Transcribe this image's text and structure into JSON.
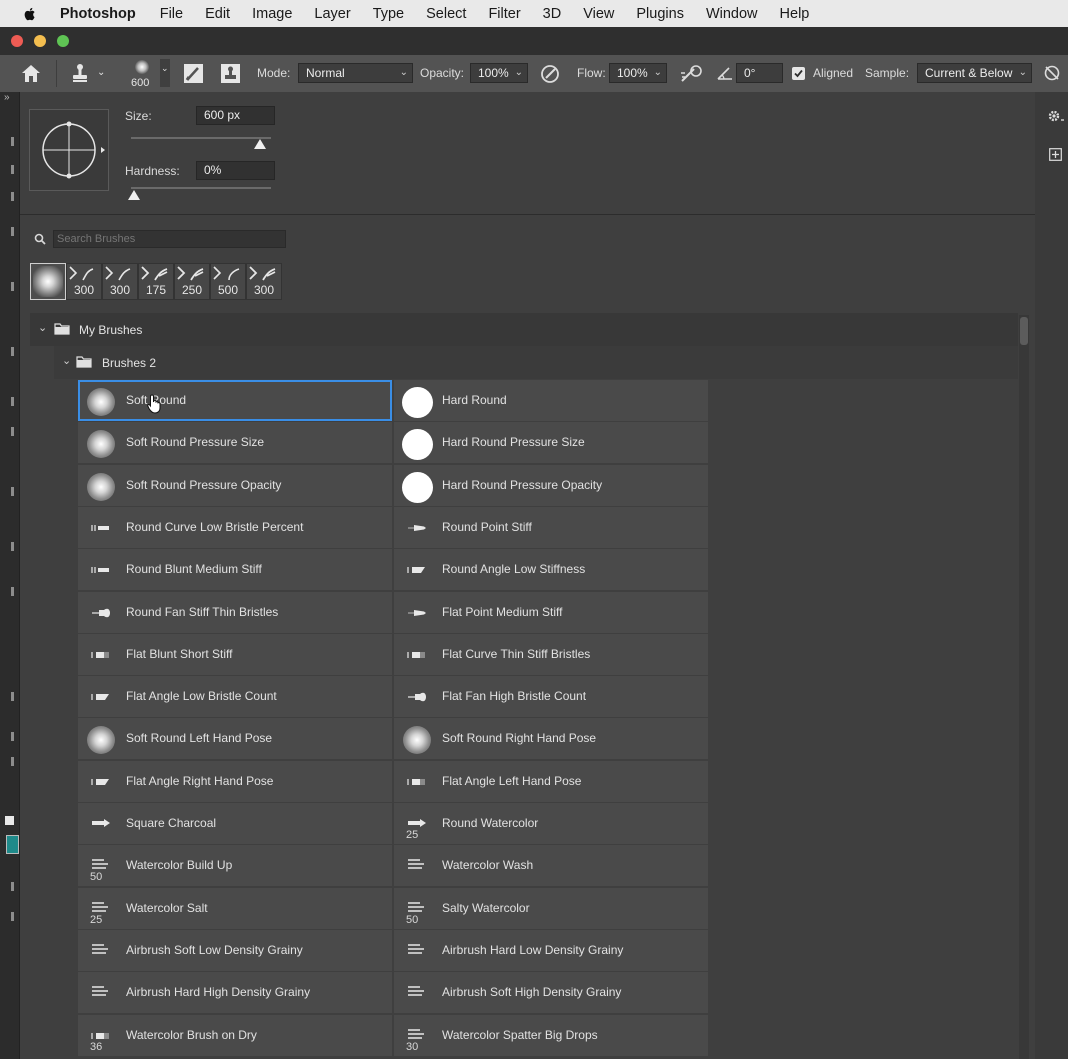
{
  "menubar": {
    "app_name": "Photoshop",
    "items": [
      "File",
      "Edit",
      "Image",
      "Layer",
      "Type",
      "Select",
      "Filter",
      "3D",
      "View",
      "Plugins",
      "Window",
      "Help"
    ]
  },
  "options_bar": {
    "brush_size_preview": "600",
    "mode_label": "Mode:",
    "mode_value": "Normal",
    "opacity_label": "Opacity:",
    "opacity_value": "100%",
    "flow_label": "Flow:",
    "flow_value": "100%",
    "angle_value": "0°",
    "aligned_label": "Aligned",
    "aligned_checked": true,
    "sample_label": "Sample:",
    "sample_value": "Current & Below"
  },
  "brush_panel": {
    "size_label": "Size:",
    "size_value": "600 px",
    "size_fraction": 0.92,
    "hardness_label": "Hardness:",
    "hardness_value": "0%",
    "hardness_fraction": 0.0,
    "search_placeholder": "Search Brushes",
    "recent_brushes": [
      "300",
      "300",
      "175",
      "250",
      "500",
      "300"
    ],
    "folder_root": "My Brushes",
    "folder_sub": "Brushes 2",
    "brushes": [
      {
        "name": "Soft Round",
        "thumb": "soft",
        "size": "",
        "selected": true
      },
      {
        "name": "Hard Round",
        "thumb": "hard",
        "size": ""
      },
      {
        "name": "Soft Round Pressure Size",
        "thumb": "soft",
        "size": ""
      },
      {
        "name": "Hard Round Pressure Size",
        "thumb": "hard",
        "size": ""
      },
      {
        "name": "Soft Round Pressure Opacity",
        "thumb": "soft",
        "size": ""
      },
      {
        "name": "Hard Round Pressure Opacity",
        "thumb": "hard",
        "size": ""
      },
      {
        "name": "Round Curve Low Bristle Percent",
        "thumb": "bristle",
        "size": ""
      },
      {
        "name": "Round Point Stiff",
        "thumb": "point",
        "size": ""
      },
      {
        "name": "Round Blunt Medium Stiff",
        "thumb": "bristle",
        "size": ""
      },
      {
        "name": "Round Angle Low Stiffness",
        "thumb": "angle",
        "size": ""
      },
      {
        "name": "Round Fan Stiff Thin Bristles",
        "thumb": "fan",
        "size": ""
      },
      {
        "name": "Flat Point Medium Stiff",
        "thumb": "point",
        "size": ""
      },
      {
        "name": "Flat Blunt Short Stiff",
        "thumb": "flat",
        "size": ""
      },
      {
        "name": "Flat Curve Thin Stiff Bristles",
        "thumb": "flat",
        "size": ""
      },
      {
        "name": "Flat Angle Low Bristle Count",
        "thumb": "angle",
        "size": ""
      },
      {
        "name": "Flat Fan High Bristle Count",
        "thumb": "fan",
        "size": ""
      },
      {
        "name": "Soft Round Left Hand Pose",
        "thumb": "soft",
        "size": ""
      },
      {
        "name": "Soft Round Right Hand Pose",
        "thumb": "soft",
        "size": ""
      },
      {
        "name": "Flat Angle Right Hand Pose",
        "thumb": "angle",
        "size": ""
      },
      {
        "name": "Flat Angle Left Hand Pose",
        "thumb": "flat",
        "size": ""
      },
      {
        "name": "Square Charcoal",
        "thumb": "arrow",
        "size": ""
      },
      {
        "name": "Round Watercolor",
        "thumb": "arrow",
        "size": "25"
      },
      {
        "name": "Watercolor Build Up",
        "thumb": "lines",
        "size": "50"
      },
      {
        "name": "Watercolor Wash",
        "thumb": "lines",
        "size": ""
      },
      {
        "name": "Watercolor Salt",
        "thumb": "lines",
        "size": "25"
      },
      {
        "name": "Salty Watercolor",
        "thumb": "lines",
        "size": "50"
      },
      {
        "name": "Airbrush Soft Low Density Grainy",
        "thumb": "lines",
        "size": ""
      },
      {
        "name": "Airbrush Hard Low Density Grainy",
        "thumb": "lines",
        "size": ""
      },
      {
        "name": "Airbrush Hard High Density Grainy",
        "thumb": "lines",
        "size": ""
      },
      {
        "name": "Airbrush Soft High Density Grainy",
        "thumb": "lines",
        "size": ""
      },
      {
        "name": "Watercolor Brush on Dry",
        "thumb": "flat",
        "size": "36"
      },
      {
        "name": "Watercolor Spatter Big Drops",
        "thumb": "lines",
        "size": "30"
      }
    ]
  },
  "colors": {
    "selection": "#3a8ee6",
    "close": "#ee5c54",
    "minimize": "#f4be4f",
    "zoom": "#5fc454",
    "foreground_swatch": "#1f8a8a"
  }
}
